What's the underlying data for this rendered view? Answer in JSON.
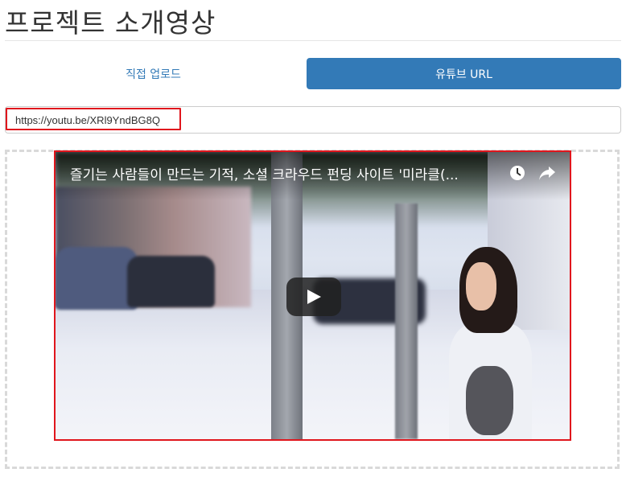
{
  "page": {
    "title": "프로젝트 소개영상"
  },
  "tabs": [
    {
      "label": "직접 업로드",
      "active": false
    },
    {
      "label": "유튜브 URL",
      "active": true
    }
  ],
  "url_input": {
    "value": "https://youtu.be/XRl9YndBG8Q",
    "placeholder": ""
  },
  "video": {
    "title": "즐기는 사람들이 만드는 기적, 소셜 크라우드 펀딩 사이트 '미라클(...",
    "icons": [
      "watch-later-icon",
      "share-icon",
      "play-icon"
    ]
  },
  "colors": {
    "accent": "#337ab7",
    "highlight": "#e0161d",
    "dashed_border": "#d9d9d9"
  }
}
